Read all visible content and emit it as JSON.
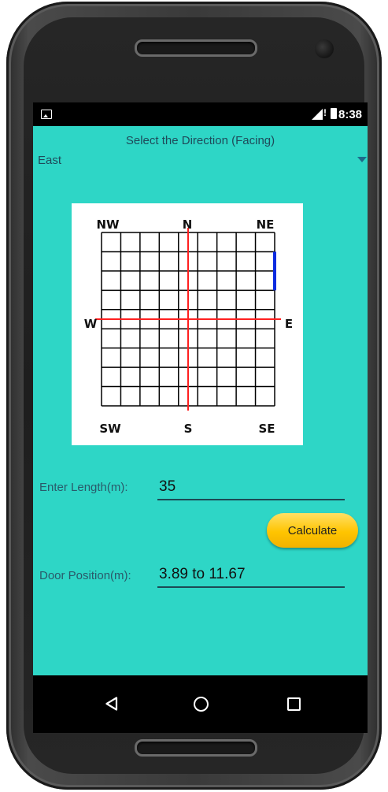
{
  "status_bar": {
    "time": "8:38",
    "alert_mark": "!"
  },
  "direction": {
    "label": "Select the Direction (Facing)",
    "selected": "East"
  },
  "compass": {
    "labels": {
      "nw": "NW",
      "n": "N",
      "ne": "NE",
      "w": "W",
      "e": "E",
      "sw": "SW",
      "s": "S",
      "se": "SE"
    },
    "grid_cells": 9,
    "highlight_side": "east",
    "highlight_cells": [
      1,
      2
    ],
    "colors": {
      "axis": "#ff2020",
      "highlight": "#0a2be0",
      "grid": "#000000"
    }
  },
  "length_field": {
    "label": "Enter Length(m):",
    "value": "35"
  },
  "calculate_button": {
    "label": "Calculate"
  },
  "door_field": {
    "label": "Door Position(m):",
    "value": "3.89 to 11.67"
  },
  "colors": {
    "screen_bg": "#2ed6c6",
    "button": "#ffc400"
  },
  "nav": {
    "back_icon": "back-triangle",
    "home_icon": "home-circle",
    "recent_icon": "recent-square"
  }
}
